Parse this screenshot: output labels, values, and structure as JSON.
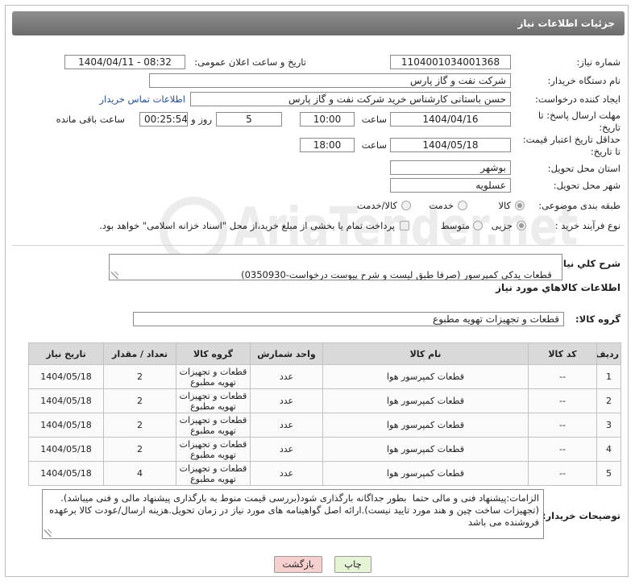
{
  "page": {
    "title": "جزئیات اطلاعات نیاز"
  },
  "watermark": {
    "text": "AriaTender.net"
  },
  "need_number": {
    "label": "شماره نیاز:",
    "value": "1104001034001368"
  },
  "announce": {
    "label": "تاریخ و ساعت اعلان عمومی:",
    "value": "1404/04/11 - 08:32"
  },
  "buyer_org": {
    "label": "نام دستگاه خریدار:",
    "value": "شرکت نفت و گاز پارس"
  },
  "requester": {
    "label": "ایجاد کننده درخواست:",
    "value": "حسن باستانی کارشناس خرید شرکت نفت و گاز پارس",
    "contact_link": "اطلاعات تماس خریدار"
  },
  "deadline": {
    "label_line1": "مهلت ارسال پاسخ: تا",
    "label_line2": "تاریخ:",
    "date": "1404/04/16",
    "time_label": "ساعت",
    "time": "10:00",
    "days": "5",
    "days_label": "روز و",
    "remaining": "00:25:54",
    "remaining_label": "ساعت باقی مانده"
  },
  "price_validity": {
    "label_line1": "حداقل تاریخ اعتبار قیمت:",
    "label_line2": "تا تاریخ:",
    "date": "1404/05/18",
    "time_label": "ساعت",
    "time": "18:00"
  },
  "province": {
    "label": "استان محل تحویل:",
    "value": "بوشهر"
  },
  "city": {
    "label": "شهر محل تحویل:",
    "value": "عسلویه"
  },
  "category": {
    "label": "طبقه بندی موضوعی:",
    "options": [
      "کالا",
      "خدمت",
      "کالا/خدمت"
    ],
    "selected": "کالا"
  },
  "process": {
    "label": "نوع فرآیند خرید :",
    "options": [
      "جزیی",
      "متوسط"
    ],
    "selected": "جزیی",
    "treasury_note": "پرداخت تمام یا بخشی از مبلغ خرید،از محل \"اسناد خزانه اسلامی\" خواهد بود.",
    "treasury_checked": false
  },
  "description": {
    "label": "شرح کلي نياز:",
    "value": "قطعات یدکی کمپرسور (صرفا طبق لیست و شرح پیوست درخواست-0350930)"
  },
  "goods": {
    "section_title": "اطلاعات کالاهاي مورد نياز",
    "group_label": "گروه کالا:",
    "group_value": "قطعات و تجهیزات تهویه مطبوع",
    "table": {
      "headers": [
        "ردیف",
        "کد کالا",
        "نام کالا",
        "واحد شمارش",
        "گروه کالا",
        "تعداد / مقدار",
        "تاریخ نیاز"
      ],
      "rows": [
        {
          "row": "1",
          "code": "--",
          "name": "قطعات کمپرسور هوا",
          "unit": "عدد",
          "group": "قطعات و تجهیزات تهویه مطبوع",
          "qty": "2",
          "date": "1404/05/18"
        },
        {
          "row": "2",
          "code": "--",
          "name": "قطعات کمپرسور هوا",
          "unit": "عدد",
          "group": "قطعات و تجهیزات تهویه مطبوع",
          "qty": "2",
          "date": "1404/05/18"
        },
        {
          "row": "3",
          "code": "--",
          "name": "قطعات کمپرسور هوا",
          "unit": "عدد",
          "group": "قطعات و تجهیزات تهویه مطبوع",
          "qty": "2",
          "date": "1404/05/18"
        },
        {
          "row": "4",
          "code": "--",
          "name": "قطعات کمپرسور هوا",
          "unit": "عدد",
          "group": "قطعات و تجهیزات تهویه مطبوع",
          "qty": "2",
          "date": "1404/05/18"
        },
        {
          "row": "5",
          "code": "--",
          "name": "قطعات کمپرسور هوا",
          "unit": "عدد",
          "group": "قطعات و تجهیزات تهویه مطبوع",
          "qty": "4",
          "date": "1404/05/18"
        }
      ]
    }
  },
  "buyer_notes": {
    "label": "توضیحات خریدار:",
    "value": "الزامات:پیشنهاد فنی و مالی حتما  بطور جداگانه بارگذاری شود(بررسی قیمت منوط به بارگذاری پیشنهاد مالی و فنی میباشد).(تجهیزات ساخت چین و هند مورد تایید نیست).ارائه اصل گواهینامه های مورد نیاز در زمان تحویل.هزینه ارسال/عودت کالا برعهده فروشنده می باشد"
  },
  "buttons": {
    "print": "چاپ",
    "back": "بازگشت"
  }
}
